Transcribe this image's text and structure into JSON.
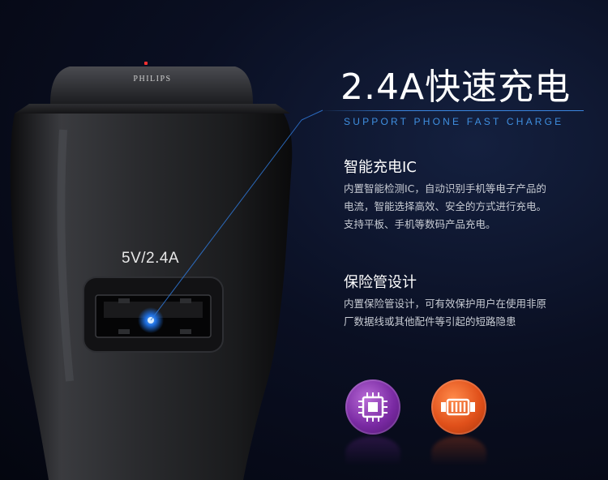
{
  "product": {
    "brand": "PHILIPS",
    "usb_label": "5V/2.4A"
  },
  "headline": {
    "title": "2.4A快速充电",
    "subtitle": "SUPPORT PHONE FAST CHARGE"
  },
  "features": [
    {
      "title": "智能充电IC",
      "body": "内置智能检测IC，自动识别手机等电子产品的电流，智能选择高效、安全的方式进行充电。支持平板、手机等数码产品充电。",
      "icon": "chip-icon"
    },
    {
      "title": "保险管设计",
      "body": "内置保险管设计，可有效保护用户在使用非原厂数据线或其他配件等引起的短路隐患",
      "icon": "fuse-icon"
    }
  ],
  "colors": {
    "accent_blue": "#3f8fe0",
    "chip_purple": "#7a2aa3",
    "fuse_orange": "#e0501a"
  }
}
